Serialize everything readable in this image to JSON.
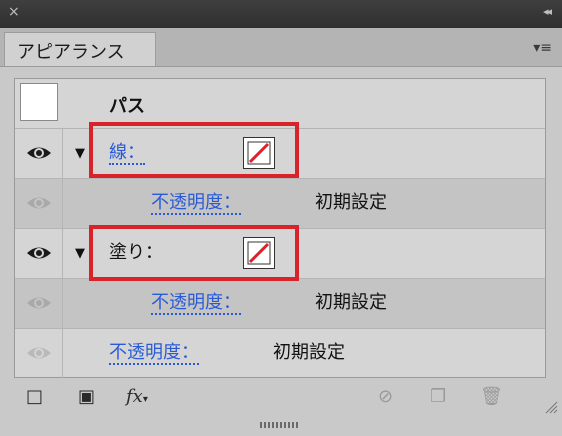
{
  "window": {
    "close_glyph": "×",
    "collapse_glyph": "◂◂"
  },
  "tab": {
    "title": "アピアランス"
  },
  "menu_icon": "≡",
  "path_row": {
    "label": "パス"
  },
  "stroke_row": {
    "label": "線：",
    "swatch": "none"
  },
  "stroke_opacity_row": {
    "label": "不透明度：",
    "value": "初期設定"
  },
  "fill_row": {
    "label": "塗り：",
    "swatch": "none"
  },
  "fill_opacity_row": {
    "label": "不透明度：",
    "value": "初期設定"
  },
  "object_opacity_row": {
    "label": "不透明度：",
    "value": "初期設定"
  },
  "toolbar": {
    "add_stroke_icon": "□",
    "add_fill_icon": "▣",
    "fx_label": "fx",
    "clear_icon": "⊘",
    "duplicate_icon": "❐",
    "delete_icon": "🗑"
  },
  "colors": {
    "highlight": "#d9232a",
    "link": "#2a5bd7",
    "panel_bg": "#c9c9c9"
  }
}
